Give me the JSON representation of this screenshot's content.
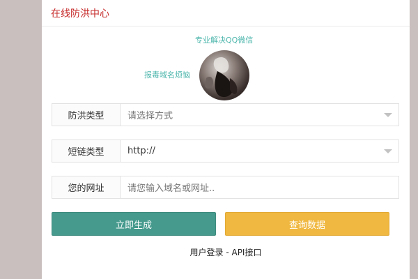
{
  "panel": {
    "title": "在线防洪中心"
  },
  "promo": {
    "line1": "专业解决QQ微信",
    "line2": "报毒域名烦恼"
  },
  "form": {
    "protection_type": {
      "label": "防洪类型",
      "value": "请选择方式"
    },
    "short_link_type": {
      "label": "短链类型",
      "value": "http://"
    },
    "url": {
      "label": "您的网址",
      "placeholder": "请您输入域名或网址.."
    }
  },
  "buttons": {
    "generate_label": "立即生成",
    "query_label": "查询数据"
  },
  "footer": {
    "login": "用户登录",
    "separator": " - ",
    "api": "API接口"
  },
  "colors": {
    "page_bg": "#c9bfbe",
    "title": "#c62828",
    "promo_text": "#4db6ac",
    "primary_button": "#459a8d",
    "warning_button": "#f0b840"
  },
  "icons": {
    "select_caret": "caret-down-icon"
  }
}
